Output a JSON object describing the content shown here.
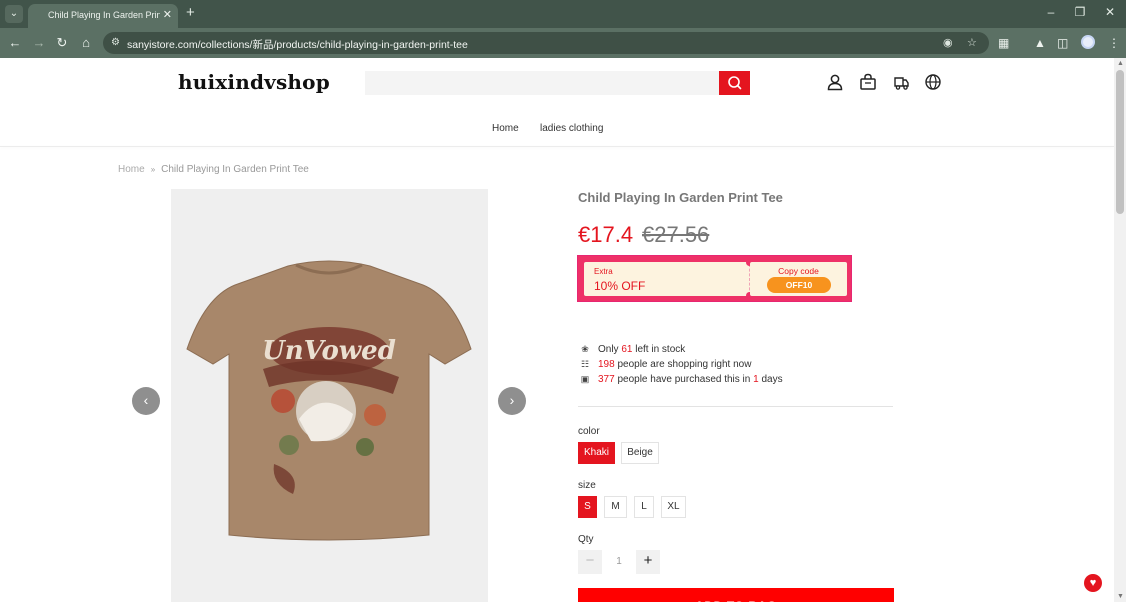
{
  "browser": {
    "tab_title": "Child Playing In Garden Print Te",
    "url": "sanyistore.com/collections/新品/products/child-playing-in-garden-print-tee"
  },
  "site": {
    "logo": "huixindvshop",
    "search": {
      "value": "",
      "placeholder": ""
    },
    "nav": [
      "Home",
      "ladies clothing"
    ]
  },
  "breadcrumb": {
    "home": "Home",
    "separator": "»",
    "current": "Child Playing In Garden Print Tee"
  },
  "product": {
    "title": "Child Playing In Garden Print Tee",
    "price": "€17.4",
    "compare_price": "€27.56",
    "coupon": {
      "extra_label": "Extra",
      "extra_value": "10% OFF",
      "copy_label": "Copy code",
      "code": "OFF10"
    },
    "stats": {
      "stock": {
        "pre": "Only ",
        "num": "61",
        "post": " left in stock"
      },
      "shopping": {
        "num": "198",
        "post": " people are shopping right now"
      },
      "purchased": {
        "num": "377",
        "mid": " people have purchased this in ",
        "days": "1",
        "post": " days"
      }
    },
    "color_label": "color",
    "colors": [
      "Khaki",
      "Beige"
    ],
    "selected_color": "Khaki",
    "size_label": "size",
    "sizes": [
      "S",
      "M",
      "L",
      "XL"
    ],
    "selected_size": "S",
    "qty_label": "Qty",
    "qty": "1",
    "add_to_bag": "ADD TO BAG"
  },
  "colors": {
    "accent": "#e4151f",
    "browser_frame": "#41544a",
    "coupon_border": "#ee3167",
    "coupon_bg": "#fdf3df",
    "copy_button": "#f7931e"
  },
  "icons": [
    "search-icon",
    "account-icon",
    "cart-icon",
    "shipping-icon",
    "language-icon",
    "gift-icon"
  ]
}
